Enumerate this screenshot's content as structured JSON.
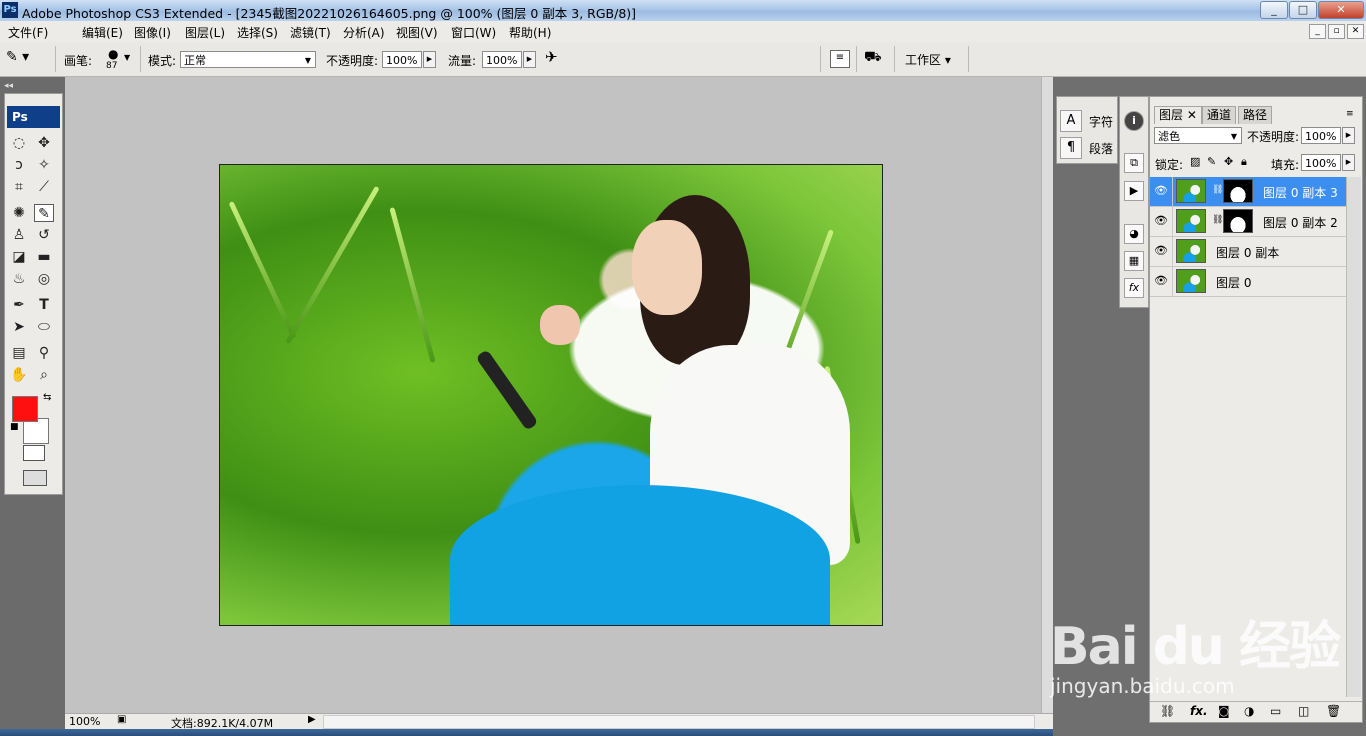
{
  "window": {
    "app_icon": "Ps",
    "title": "Adobe Photoshop CS3 Extended - [2345截图20221026164605.png @ 100% (图层 0 副本 3, RGB/8)]",
    "buttons": {
      "minimize": "_",
      "maximize": "□",
      "close": "✕"
    }
  },
  "menu": [
    "文件(F)",
    "编辑(E)",
    "图像(I)",
    "图层(L)",
    "选择(S)",
    "滤镜(T)",
    "分析(A)",
    "视图(V)",
    "窗口(W)",
    "帮助(H)"
  ],
  "doc_buttons": {
    "min": "_",
    "restore": "▫",
    "close": "✕"
  },
  "options": {
    "brush_label": "画笔:",
    "brush_size": "87",
    "mode_label": "模式:",
    "mode_value": "正常",
    "opacity_label": "不透明度:",
    "opacity_value": "100%",
    "flow_label": "流量:",
    "flow_value": "100%",
    "workspace": "工作区 ▾"
  },
  "toolbox": {
    "logo": "Ps"
  },
  "status": {
    "zoom": "100%",
    "doc": "文档:892.1K/4.07M"
  },
  "dock": {
    "character": "字符",
    "paragraph": "段落"
  },
  "layers_panel": {
    "tabs": [
      "图层",
      "通道",
      "路径"
    ],
    "blend_mode": "滤色",
    "opacity_label": "不透明度:",
    "opacity_value": "100%",
    "lock_label": "锁定:",
    "fill_label": "填充:",
    "fill_value": "100%",
    "layers": [
      {
        "name": "图层 0 副本 3",
        "has_mask": true,
        "active": true
      },
      {
        "name": "图层 0 副本 2",
        "has_mask": true,
        "active": false
      },
      {
        "name": "图层 0 副本",
        "has_mask": false,
        "active": false
      },
      {
        "name": "图层 0",
        "has_mask": false,
        "active": false
      }
    ],
    "footer_fx": "fx."
  },
  "watermark": {
    "line1": "Bai du 经验",
    "line2": "jingyan.baidu.com"
  },
  "colors": {
    "foreground": "#ff1010",
    "background": "#ffffff",
    "selection": "#3c8ff0"
  }
}
